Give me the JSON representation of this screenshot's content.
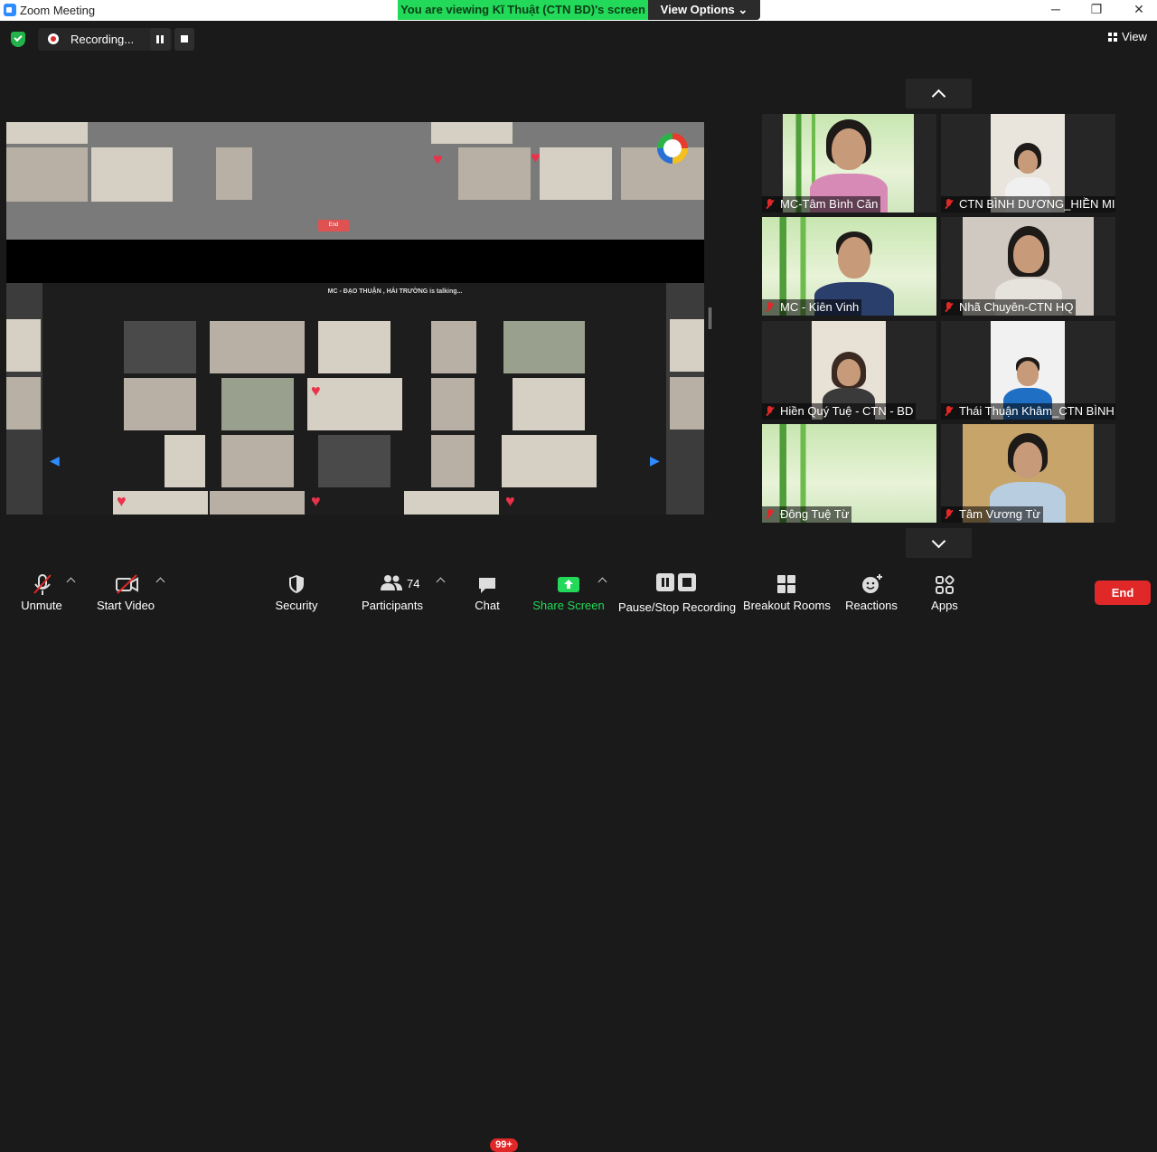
{
  "window": {
    "title": "Zoom Meeting",
    "share_banner": "You are viewing Kĩ Thuật (CTN BD)'s screen",
    "view_options": "View Options",
    "minimize": "─",
    "maximize": "❐",
    "close": "✕"
  },
  "recording": {
    "label": "Recording..."
  },
  "view_button": "View",
  "shared_screen": {
    "talking_label": "MC - ĐẠO THUẬN , HẢI TRƯỜNG is talking...",
    "end_label": "End"
  },
  "gallery": [
    {
      "name": "MC-Tâm Bình Căn",
      "muted": true
    },
    {
      "name": "CTN BÌNH DƯƠNG_HIỀN MI...",
      "muted": true
    },
    {
      "name": "MC - Kiên Vinh",
      "muted": true
    },
    {
      "name": "Nhã Chuyên-CTN HQ",
      "muted": true
    },
    {
      "name": "Hiền Quý Tuệ - CTN - BD",
      "muted": true
    },
    {
      "name": "Thái Thuận Khâm_CTN BÌNH...",
      "muted": true
    },
    {
      "name": "Đông Tuệ Từ",
      "muted": true
    },
    {
      "name": "Tâm Vương Từ",
      "muted": true
    }
  ],
  "toolbar": {
    "unmute": "Unmute",
    "start_video": "Start Video",
    "security": "Security",
    "participants": "Participants",
    "participants_count": "74",
    "chat": "Chat",
    "chat_badge": "99+",
    "share_screen": "Share Screen",
    "pause_stop_recording": "Pause/Stop Recording",
    "breakout_rooms": "Breakout Rooms",
    "reactions": "Reactions",
    "apps": "Apps",
    "end": "End"
  },
  "colors": {
    "accent_green": "#23d959",
    "end_red": "#e02828",
    "background": "#1a1a1a"
  }
}
